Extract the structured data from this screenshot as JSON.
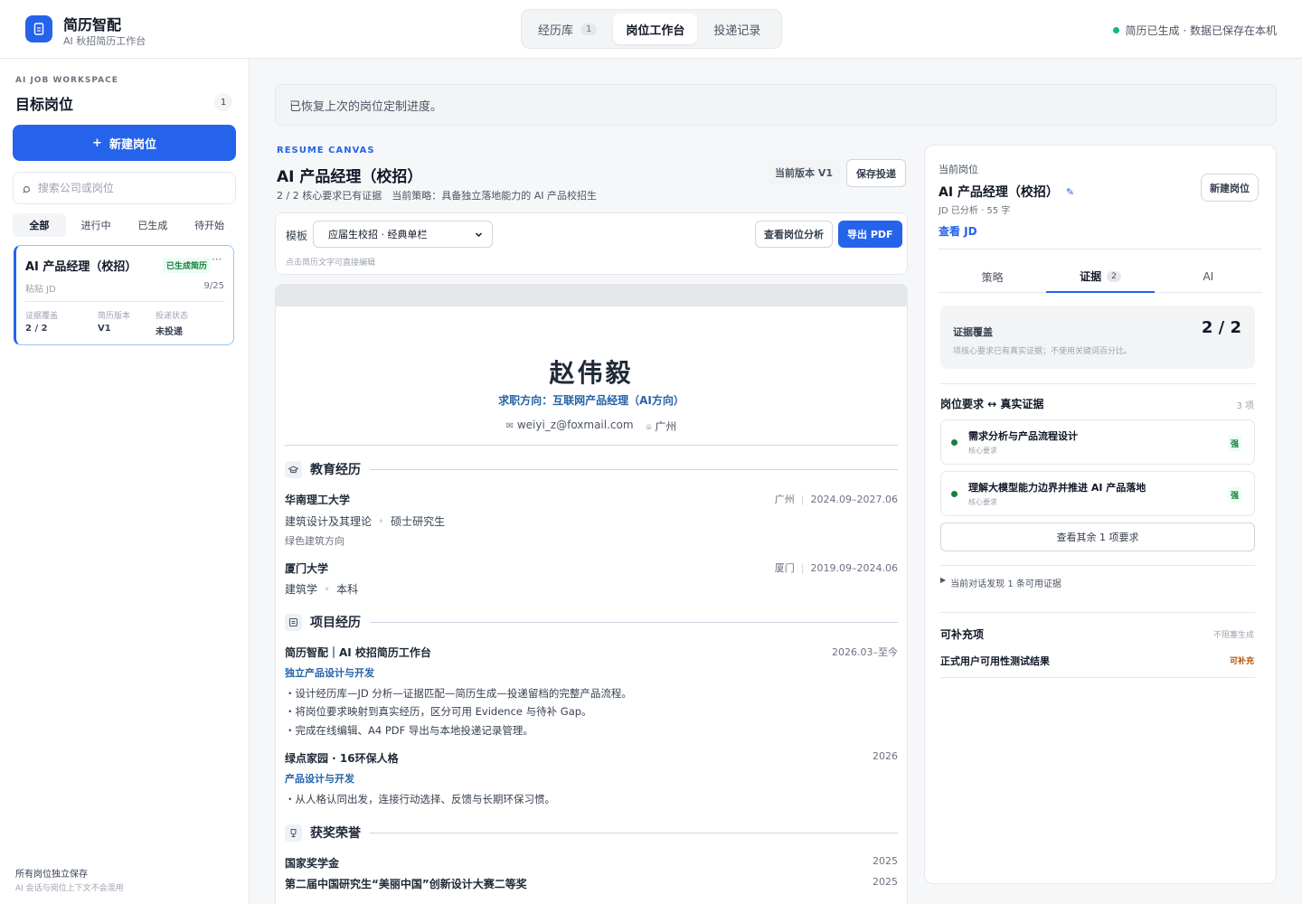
{
  "app": {
    "title": "简历智配",
    "subtitle": "AI 秋招简历工作台",
    "status": "简历已生成 · 数据已保存在本机"
  },
  "nav": {
    "tabs": [
      {
        "label": "经历库",
        "count": "1"
      },
      {
        "label": "岗位工作台"
      },
      {
        "label": "投递记录"
      }
    ]
  },
  "sidebar": {
    "kicker": "AI JOB WORKSPACE",
    "title": "目标岗位",
    "count": "1",
    "new_button": "新建岗位",
    "search_placeholder": "搜索公司或岗位",
    "filters": [
      "全部",
      "进行中",
      "已生成",
      "待开始"
    ],
    "job": {
      "title": "AI 产品经理（校招）",
      "badge": "已生成简历",
      "more": "···",
      "source": "粘贴 JD",
      "date": "9/25",
      "stats": [
        {
          "label": "证据覆盖",
          "value": "2 / 2"
        },
        {
          "label": "简历版本",
          "value": "V1"
        },
        {
          "label": "投递状态",
          "value": "未投递"
        }
      ]
    },
    "footer_title": "所有岗位独立保存",
    "footer_note": "AI 会话与岗位上下文不会混用"
  },
  "restore_notice": "已恢复上次的岗位定制进度。",
  "canvas": {
    "kicker": "RESUME CANVAS",
    "title": "AI 产品经理（校招）",
    "meta": "2 / 2 核心要求已有证据　当前策略：具备独立落地能力的 AI 产品校招生",
    "version": "当前版本 V1",
    "save_button": "保存投递",
    "template_label": "模板",
    "template_value": "应届生校招 · 经典单栏",
    "template_options": [
      "应届生校招 · 经典单栏"
    ],
    "hint": "点击简历文字可直接编辑",
    "analysis_button": "查看岗位分析",
    "export_button": "导出 PDF"
  },
  "resume": {
    "name": "赵伟毅",
    "objective": "求职方向：互联网产品经理（AI方向）",
    "email": "weiyi_z@foxmail.com",
    "city": "广州",
    "sections": {
      "education": "教育经历",
      "projects": "项目经历",
      "awards": "获奖荣誉"
    },
    "education": [
      {
        "school": "华南理工大学",
        "city": "广州",
        "period": "2024.09–2027.06",
        "major": "建筑设计及其理论",
        "degree": "硕士研究生",
        "note": "绿色建筑方向"
      },
      {
        "school": "厦门大学",
        "city": "厦门",
        "period": "2019.09–2024.06",
        "major": "建筑学",
        "degree": "本科"
      }
    ],
    "projects": [
      {
        "title": "简历智配｜AI 校招简历工作台",
        "period": "2026.03–至今",
        "role": "独立产品设计与开发",
        "bullets": [
          "・设计经历库—JD 分析—证据匹配—简历生成—投递留档的完整产品流程。",
          "・将岗位要求映射到真实经历，区分可用 Evidence 与待补 Gap。",
          "・完成在线编辑、A4 PDF 导出与本地投递记录管理。"
        ]
      },
      {
        "title": "绿点家园 · 16环保人格",
        "period": "2026",
        "role": "产品设计与开发",
        "bullets": [
          "・从人格认同出发，连接行动选择、反馈与长期环保习惯。"
        ]
      }
    ],
    "awards": [
      {
        "title": "国家奖学金",
        "year": "2025"
      },
      {
        "title": "第二届中国研究生“美丽中国”创新设计大赛二等奖",
        "year": "2025"
      }
    ]
  },
  "panel": {
    "kicker": "当前岗位",
    "title": "AI 产品经理（校招）",
    "meta": "JD 已分析 · 55 字",
    "view_jd": "查看 JD",
    "new_button": "新建岗位",
    "tabs": [
      {
        "label": "策略"
      },
      {
        "label": "证据",
        "count": "2"
      },
      {
        "label": "AI"
      }
    ],
    "coverage_label": "证据覆盖",
    "coverage_desc": "项核心要求已有真实证据；不使用关键词百分比。",
    "coverage_value": "2 / 2",
    "req_head": "岗位要求 ↔ 真实证据",
    "req_count": "3 项",
    "requirements": [
      {
        "title": "需求分析与产品流程设计",
        "sub": "核心要求",
        "tag": "强"
      },
      {
        "title": "理解大模型能力边界并推进 AI 产品落地",
        "sub": "核心要求",
        "tag": "强"
      }
    ],
    "more_button": "查看其余 1 项要求",
    "conversation_found": "当前对话发现 1 条可用证据",
    "supplement_head": "可补充项",
    "supplement_note": "不阻塞生成",
    "supplement_item": "正式用户可用性测试结果",
    "supplement_tag": "可补充"
  }
}
